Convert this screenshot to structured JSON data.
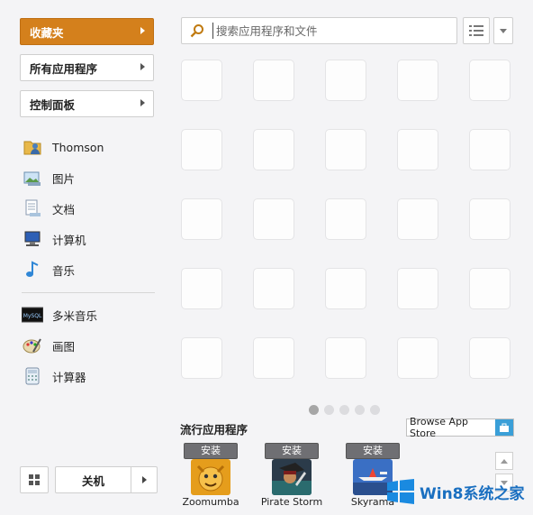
{
  "sidebar": {
    "menus": [
      {
        "label": "收藏夹"
      },
      {
        "label": "所有应用程序"
      },
      {
        "label": "控制面板"
      }
    ],
    "places": [
      {
        "label": "Thomson",
        "icon": "user-folder-icon"
      },
      {
        "label": "图片",
        "icon": "pictures-icon"
      },
      {
        "label": "文档",
        "icon": "documents-icon"
      },
      {
        "label": "计算机",
        "icon": "computer-icon"
      },
      {
        "label": "音乐",
        "icon": "music-icon"
      }
    ],
    "apps": [
      {
        "label": "多米音乐",
        "icon": "duomi-music-icon",
        "icon_text": "MySQL"
      },
      {
        "label": "画图",
        "icon": "paint-icon"
      },
      {
        "label": "计算器",
        "icon": "calculator-icon"
      }
    ],
    "shutdown_label": "关机"
  },
  "search": {
    "placeholder": "搜索应用程序和文件"
  },
  "grid": {
    "rows": 5,
    "cols": 5,
    "page_count": 5,
    "current_page": 1
  },
  "popular": {
    "title": "流行应用程序",
    "store_label": "Browse App Store",
    "apps": [
      {
        "name": "Zoomumba",
        "install_label": "安装",
        "icon": "zoomumba-icon"
      },
      {
        "name": "Pirate Storm",
        "install_label": "安装",
        "icon": "pirate-storm-icon"
      },
      {
        "name": "Skyrama",
        "install_label": "安装",
        "icon": "skyrama-icon"
      }
    ]
  },
  "watermark": {
    "text": "Win8系统之家"
  },
  "colors": {
    "accent": "#d4801c",
    "background": "#f4f4f6",
    "store_blue": "#3a9fd8"
  }
}
